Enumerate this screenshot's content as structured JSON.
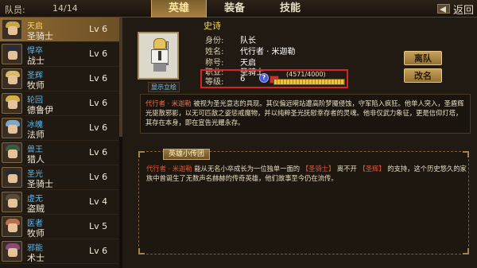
{
  "header": {
    "team_label": "队员:",
    "team_count": "14/14",
    "tabs": [
      "英雄",
      "装备",
      "技能"
    ],
    "active_tab": 0,
    "back_label": "返回"
  },
  "roster": [
    {
      "nick": "天启",
      "cls": "圣骑士",
      "lv": "Lv 6",
      "selected": true,
      "hair": "#c8a446"
    },
    {
      "nick": "悍卒",
      "cls": "战士",
      "lv": "Lv 6",
      "selected": false,
      "hair": "#2a2a3a"
    },
    {
      "nick": "圣辉",
      "cls": "牧师",
      "lv": "Lv 6",
      "selected": false,
      "hair": "#d9b86c"
    },
    {
      "nick": "轮回",
      "cls": "德鲁伊",
      "lv": "Lv 6",
      "selected": false,
      "hair": "#d4b040"
    },
    {
      "nick": "冰魄",
      "cls": "法师",
      "lv": "Lv 6",
      "selected": false,
      "hair": "#7ea6c8"
    },
    {
      "nick": "兽王",
      "cls": "猎人",
      "lv": "Lv 6",
      "selected": false,
      "hair": "#3c5a3c"
    },
    {
      "nick": "圣光",
      "cls": "圣骑士",
      "lv": "Lv 6",
      "selected": false,
      "hair": "#2a2a2a"
    },
    {
      "nick": "虚无",
      "cls": "盗贼",
      "lv": "Lv 4",
      "selected": false,
      "hair": "#5a4a3a"
    },
    {
      "nick": "医者",
      "cls": "牧师",
      "lv": "Lv 5",
      "selected": false,
      "hair": "#b8704a"
    },
    {
      "nick": "邪能",
      "cls": "术士",
      "lv": "Lv 6",
      "selected": false,
      "hair": "#8a4a7a"
    }
  ],
  "hero": {
    "rarity": "史诗",
    "show_button": "显示立绘",
    "fields": [
      {
        "label": "身份:",
        "value": "队长"
      },
      {
        "label": "姓名:",
        "value": "代行者 · 米迦勒"
      },
      {
        "label": "称号:",
        "value": "天启"
      },
      {
        "label": "职业:",
        "value": "圣骑士"
      }
    ],
    "level_label": "等级:",
    "level_value": "6",
    "help_icon": "?",
    "xp_text": "(4571/4000)",
    "xp_fraction": 1.0
  },
  "actions": {
    "leave": "离队",
    "rename": "改名"
  },
  "description": {
    "name": "代行者 · 米迦勒",
    "text": "被视为圣光意志的具现。其仪偏远嗬站遭高阶梦魇侵蚀，守军陷入疯狂。他单人突入，圣盾辉光驱散邪影，以无可匹敌之姿惩戒魔物，并以纯粹圣光抚慰幸存者的灵魂。他非仅武力象征，更是信仰灯塔，其存在本身，即在宣告光耀永存。"
  },
  "story": {
    "tag": "英雄小传团",
    "name": "代行者 · 米迦勒",
    "pre": "能从无名小卒成长为一位独单一面的",
    "cls": "【圣骑士】",
    "mid": "离不开",
    "faith": "【圣辉】",
    "post": "的支持，这个历史悠久的家族中曾诞生了无数声名赫赫的传奇英雄，他们故事至今仍在流传。"
  }
}
